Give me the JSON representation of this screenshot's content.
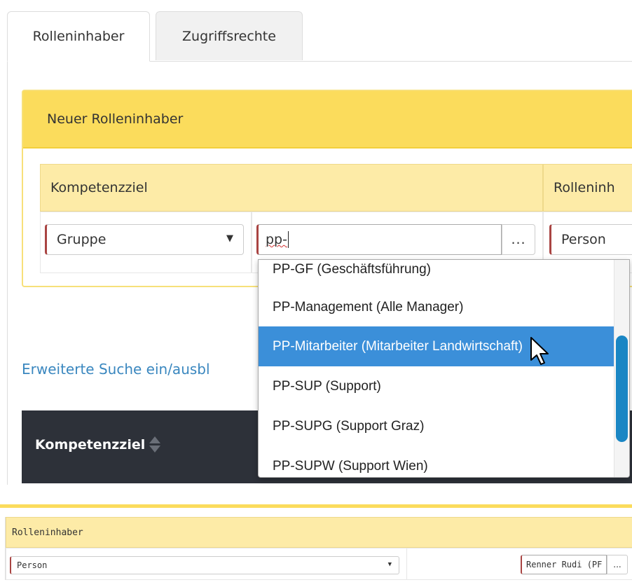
{
  "tabs": [
    {
      "label": "Rolleninhaber",
      "active": true
    },
    {
      "label": "Zugriffsrechte",
      "active": false
    }
  ],
  "panel": {
    "title": "Neuer Rolleninhaber",
    "headers": {
      "kompetenzziel": "Kompetenzziel",
      "rolleninhaber": "Rolleninh"
    },
    "type_select": {
      "value": "Gruppe"
    },
    "search_input": {
      "value": "pp-"
    },
    "lookup_button": {
      "label": "..."
    },
    "holder_select": {
      "value": "Person"
    }
  },
  "dropdown": {
    "items": [
      {
        "label": "PP-GF (Geschäftsführung)"
      },
      {
        "label": "PP-Management (Alle Manager)"
      },
      {
        "label": "PP-Mitarbeiter (Mitarbeiter Landwirtschaft)",
        "selected": true
      },
      {
        "label": "PP-SUP (Support)"
      },
      {
        "label": "PP-SUPG (Support Graz)"
      },
      {
        "label": "PP-SUPW (Support Wien)"
      }
    ]
  },
  "advanced_search": {
    "label": "Erweiterte Suche ein/ausbl"
  },
  "table": {
    "column_header": "Kompetenzziel"
  },
  "bottom": {
    "header": "Rolleninhaber",
    "select_value": "Person",
    "input_value": "Renner Rudi (PF",
    "lookup_button": "..."
  },
  "colors": {
    "panel_header": "#fbdc5c",
    "table_header": "#fdeba7",
    "selection": "#3b8fd9",
    "link": "#3a87bf",
    "dark_header": "#2d3139",
    "required_marker": "#a94442"
  }
}
